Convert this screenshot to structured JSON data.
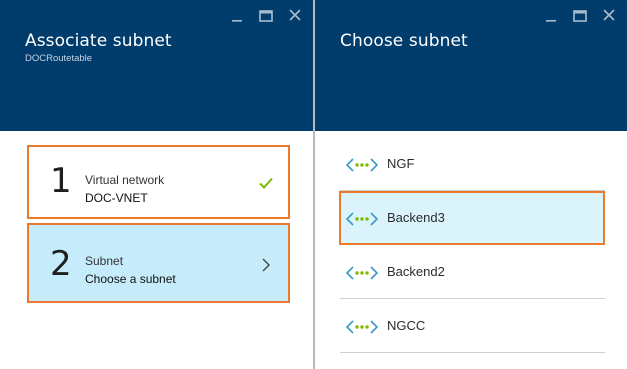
{
  "left_blade": {
    "title": "Associate subnet",
    "subtitle": "DOCRoutetable",
    "steps": [
      {
        "number": "1",
        "label": "Virtual network",
        "value": "DOC-VNET",
        "status": "complete"
      },
      {
        "number": "2",
        "label": "Subnet",
        "value": "Choose a subnet",
        "status": "active"
      }
    ]
  },
  "right_blade": {
    "title": "Choose subnet",
    "subnets": [
      {
        "name": "NGF",
        "selected": false
      },
      {
        "name": "Backend3",
        "selected": true
      },
      {
        "name": "Backend2",
        "selected": false
      },
      {
        "name": "NGCC",
        "selected": false
      }
    ]
  },
  "icons": {
    "minimize": "minimize-icon",
    "maximize": "maximize-icon",
    "close": "close-icon",
    "check": "checkmark-icon",
    "chevron": "chevron-right-icon",
    "subnet": "subnet-icon"
  },
  "colors": {
    "header_bg": "#003c6c",
    "highlight_border": "#ec7a2c",
    "active_step_bg": "#c6ecfb",
    "selected_row_bg": "#dbf4fc",
    "check_green": "#7fba00",
    "subnet_icon_blue": "#3999c6",
    "subnet_icon_green": "#7fba00"
  }
}
